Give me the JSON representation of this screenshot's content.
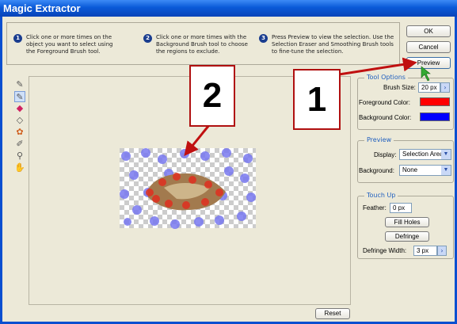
{
  "window": {
    "title": "Magic Extractor"
  },
  "steps": [
    {
      "num": "1",
      "text": "Click one or more times on the object you want to select using the Foreground Brush tool."
    },
    {
      "num": "2",
      "text": "Click one or more times with the Background Brush tool to choose the regions to exclude."
    },
    {
      "num": "3",
      "text": "Press Preview to view the selection. Use the Selection Eraser and Smoothing Brush tools to fine-tune the selection."
    }
  ],
  "buttons": {
    "ok": "OK",
    "cancel": "Cancel",
    "preview": "Preview",
    "reset": "Reset",
    "fill_holes": "Fill Holes",
    "defringe": "Defringe"
  },
  "tool_options": {
    "legend": "Tool Options",
    "brush_size_label": "Brush Size:",
    "brush_size_value": "20 px",
    "fg_label": "Foreground Color:",
    "fg_color": "#ff0000",
    "bg_label": "Background Color:",
    "bg_color": "#0000ff"
  },
  "preview": {
    "legend": "Preview",
    "display_label": "Display:",
    "display_value": "Selection Area",
    "background_label": "Background:",
    "background_value": "None"
  },
  "touch_up": {
    "legend": "Touch Up",
    "feather_label": "Feather:",
    "feather_value": "0 px",
    "defringe_width_label": "Defringe Width:",
    "defringe_width_value": "3 px"
  },
  "callouts": {
    "one": "1",
    "two": "2"
  },
  "tools": [
    "foreground-brush-icon",
    "background-brush-icon",
    "selection-eraser-icon",
    "point-eraser-icon",
    "add-to-selection-icon",
    "smoothing-brush-icon",
    "zoom-icon",
    "hand-icon"
  ]
}
